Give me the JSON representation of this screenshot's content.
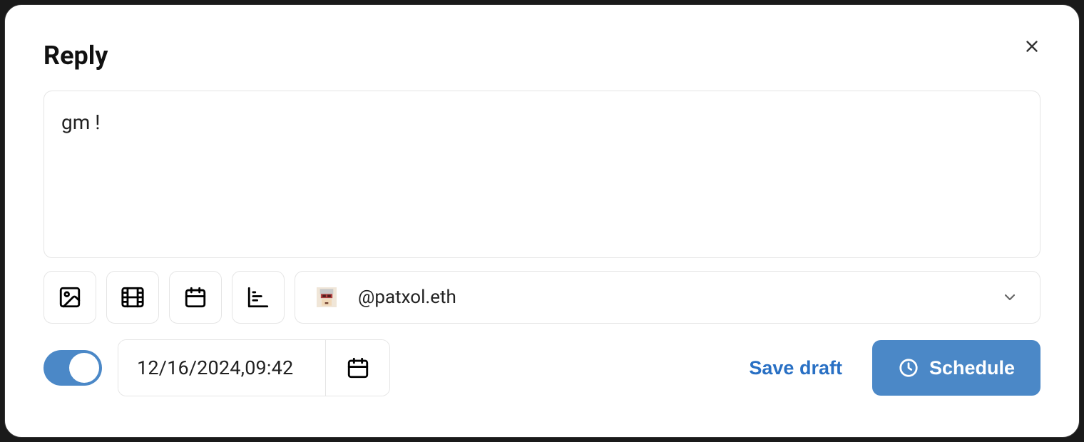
{
  "modal": {
    "title": "Reply"
  },
  "compose": {
    "text": "gm !"
  },
  "account": {
    "handle": "@patxol.eth"
  },
  "schedule": {
    "datetime": "12/16/2024,09:42"
  },
  "actions": {
    "saveDraft": "Save draft",
    "schedule": "Schedule"
  }
}
